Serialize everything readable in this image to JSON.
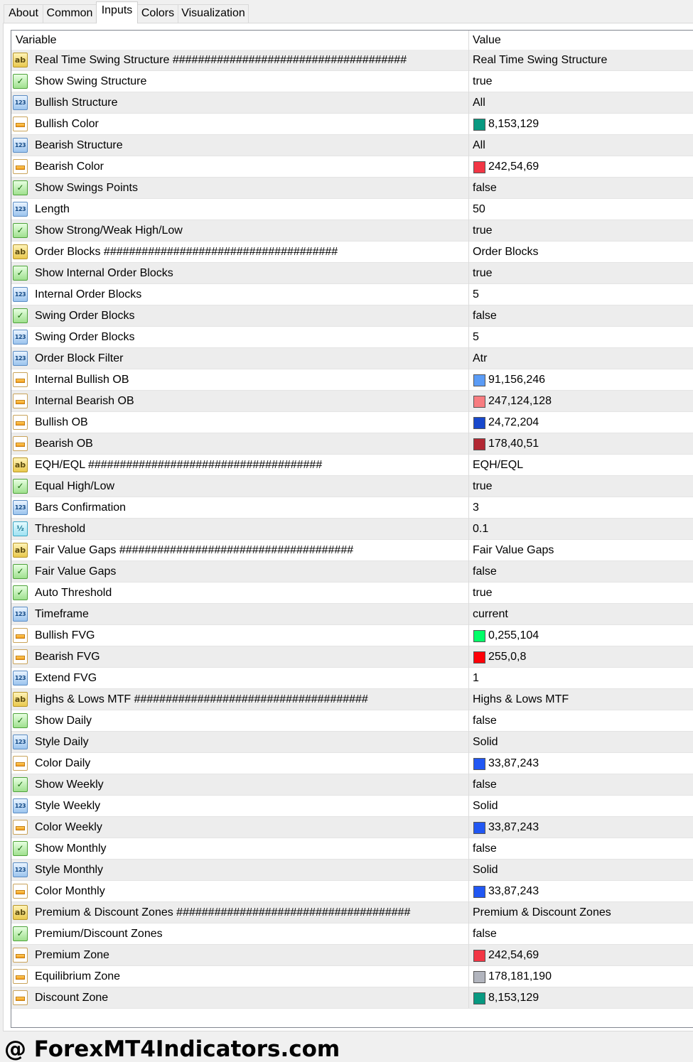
{
  "tabs": [
    {
      "label": "About",
      "active": false
    },
    {
      "label": "Common",
      "active": false
    },
    {
      "label": "Inputs",
      "active": true
    },
    {
      "label": "Colors",
      "active": false
    },
    {
      "label": "Visualization",
      "active": false
    }
  ],
  "table": {
    "col_variable": "Variable",
    "col_value": "Value",
    "rows": [
      {
        "type": "string",
        "icon": "string-type-icon",
        "icon_text": "ab",
        "name": "Real Time Swing Structure #####################################",
        "value": "Real Time Swing Structure"
      },
      {
        "type": "bool",
        "icon": "bool-type-icon",
        "icon_text": "✓",
        "name": "Show Swing Structure",
        "value": "true"
      },
      {
        "type": "int",
        "icon": "int-type-icon",
        "icon_text": "123",
        "name": "Bullish Structure",
        "value": "All"
      },
      {
        "type": "color",
        "icon": "color-type-icon",
        "name": "Bullish Color",
        "value": "8,153,129",
        "swatch": "#089981"
      },
      {
        "type": "int",
        "icon": "int-type-icon",
        "icon_text": "123",
        "name": "Bearish Structure",
        "value": "All"
      },
      {
        "type": "color",
        "icon": "color-type-icon",
        "name": "Bearish Color",
        "value": "242,54,69",
        "swatch": "#f23645"
      },
      {
        "type": "bool",
        "icon": "bool-type-icon",
        "icon_text": "✓",
        "name": "Show Swings Points",
        "value": "false"
      },
      {
        "type": "int",
        "icon": "int-type-icon",
        "icon_text": "123",
        "name": "Length",
        "value": "50"
      },
      {
        "type": "bool",
        "icon": "bool-type-icon",
        "icon_text": "✓",
        "name": "Show Strong/Weak High/Low",
        "value": "true"
      },
      {
        "type": "string",
        "icon": "string-type-icon",
        "icon_text": "ab",
        "name": "Order Blocks #####################################",
        "value": "Order Blocks"
      },
      {
        "type": "bool",
        "icon": "bool-type-icon",
        "icon_text": "✓",
        "name": "Show Internal Order Blocks",
        "value": "true"
      },
      {
        "type": "int",
        "icon": "int-type-icon",
        "icon_text": "123",
        "name": "Internal Order Blocks",
        "value": "5"
      },
      {
        "type": "bool",
        "icon": "bool-type-icon",
        "icon_text": "✓",
        "name": "Swing Order Blocks",
        "value": "false"
      },
      {
        "type": "int",
        "icon": "int-type-icon",
        "icon_text": "123",
        "name": "Swing Order Blocks",
        "value": "5"
      },
      {
        "type": "int",
        "icon": "int-type-icon",
        "icon_text": "123",
        "name": "Order Block Filter",
        "value": "Atr"
      },
      {
        "type": "color",
        "icon": "color-type-icon",
        "name": "Internal Bullish OB",
        "value": "91,156,246",
        "swatch": "#5b9cf6"
      },
      {
        "type": "color",
        "icon": "color-type-icon",
        "name": "Internal Bearish OB",
        "value": "247,124,128",
        "swatch": "#f77c80"
      },
      {
        "type": "color",
        "icon": "color-type-icon",
        "name": "Bullish OB",
        "value": "24,72,204",
        "swatch": "#1848cc"
      },
      {
        "type": "color",
        "icon": "color-type-icon",
        "name": "Bearish OB",
        "value": "178,40,51",
        "swatch": "#b22833"
      },
      {
        "type": "string",
        "icon": "string-type-icon",
        "icon_text": "ab",
        "name": "EQH/EQL #####################################",
        "value": "EQH/EQL"
      },
      {
        "type": "bool",
        "icon": "bool-type-icon",
        "icon_text": "✓",
        "name": "Equal High/Low",
        "value": "true"
      },
      {
        "type": "int",
        "icon": "int-type-icon",
        "icon_text": "123",
        "name": "Bars Confirmation",
        "value": "3"
      },
      {
        "type": "double",
        "icon": "double-type-icon",
        "icon_text": "½",
        "name": "Threshold",
        "value": "0.1"
      },
      {
        "type": "string",
        "icon": "string-type-icon",
        "icon_text": "ab",
        "name": "Fair Value Gaps #####################################",
        "value": "Fair Value Gaps"
      },
      {
        "type": "bool",
        "icon": "bool-type-icon",
        "icon_text": "✓",
        "name": "Fair Value Gaps",
        "value": "false"
      },
      {
        "type": "bool",
        "icon": "bool-type-icon",
        "icon_text": "✓",
        "name": "Auto Threshold",
        "value": "true"
      },
      {
        "type": "int",
        "icon": "int-type-icon",
        "icon_text": "123",
        "name": "Timeframe",
        "value": "current"
      },
      {
        "type": "color",
        "icon": "color-type-icon",
        "name": "Bullish FVG",
        "value": "0,255,104",
        "swatch": "#00ff68"
      },
      {
        "type": "color",
        "icon": "color-type-icon",
        "name": "Bearish FVG",
        "value": "255,0,8",
        "swatch": "#ff0008"
      },
      {
        "type": "int",
        "icon": "int-type-icon",
        "icon_text": "123",
        "name": "Extend FVG",
        "value": "1"
      },
      {
        "type": "string",
        "icon": "string-type-icon",
        "icon_text": "ab",
        "name": "Highs & Lows MTF #####################################",
        "value": "Highs & Lows MTF"
      },
      {
        "type": "bool",
        "icon": "bool-type-icon",
        "icon_text": "✓",
        "name": "Show Daily",
        "value": "false"
      },
      {
        "type": "int",
        "icon": "int-type-icon",
        "icon_text": "123",
        "name": "Style Daily",
        "value": "Solid"
      },
      {
        "type": "color",
        "icon": "color-type-icon",
        "name": "Color Daily",
        "value": "33,87,243",
        "swatch": "#2157f3"
      },
      {
        "type": "bool",
        "icon": "bool-type-icon",
        "icon_text": "✓",
        "name": "Show Weekly",
        "value": "false"
      },
      {
        "type": "int",
        "icon": "int-type-icon",
        "icon_text": "123",
        "name": "Style Weekly",
        "value": "Solid"
      },
      {
        "type": "color",
        "icon": "color-type-icon",
        "name": "Color Weekly",
        "value": "33,87,243",
        "swatch": "#2157f3"
      },
      {
        "type": "bool",
        "icon": "bool-type-icon",
        "icon_text": "✓",
        "name": "Show Monthly",
        "value": "false"
      },
      {
        "type": "int",
        "icon": "int-type-icon",
        "icon_text": "123",
        "name": "Style Monthly",
        "value": "Solid"
      },
      {
        "type": "color",
        "icon": "color-type-icon",
        "name": "Color Monthly",
        "value": "33,87,243",
        "swatch": "#2157f3"
      },
      {
        "type": "string",
        "icon": "string-type-icon",
        "icon_text": "ab",
        "name": "Premium & Discount Zones #####################################",
        "value": "Premium & Discount Zones"
      },
      {
        "type": "bool",
        "icon": "bool-type-icon",
        "icon_text": "✓",
        "name": "Premium/Discount Zones",
        "value": "false"
      },
      {
        "type": "color",
        "icon": "color-type-icon",
        "name": "Premium Zone",
        "value": "242,54,69",
        "swatch": "#f23645"
      },
      {
        "type": "color",
        "icon": "color-type-icon",
        "name": "Equilibrium Zone",
        "value": "178,181,190",
        "swatch": "#b2b5be"
      },
      {
        "type": "color",
        "icon": "color-type-icon",
        "name": "Discount Zone",
        "value": "8,153,129",
        "swatch": "#089981"
      }
    ]
  },
  "watermark": "@ ForexMT4Indicators.com"
}
